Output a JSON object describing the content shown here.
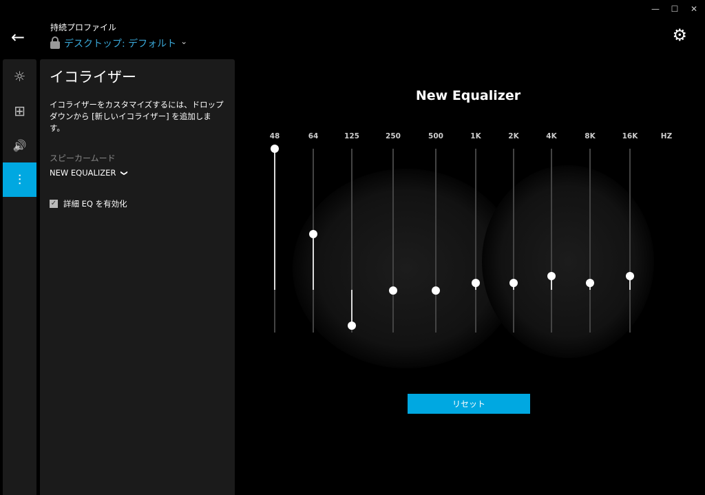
{
  "window": {
    "minimize": "—",
    "maximize": "☐",
    "close": "✕"
  },
  "header": {
    "back_icon": "←",
    "profile_label": "持続プロファイル",
    "profile_value": "デスクトップ: デフォルト",
    "chevron": "⌄",
    "settings_icon": "⚙"
  },
  "rail": {
    "items": [
      {
        "icon": "☼",
        "name": "lighting"
      },
      {
        "icon": "⊞",
        "name": "assignments"
      },
      {
        "icon": "🔊",
        "name": "sound"
      },
      {
        "icon": "⫶",
        "name": "equalizer"
      }
    ]
  },
  "panel": {
    "title": "イコライザー",
    "description": "イコライザーをカスタマイズするには、ドロップダウンから [新しいイコライザー] を追加します。",
    "mode_label": "スピーカームード",
    "mode_value": "NEW EQUALIZER",
    "mode_chevron": "❯",
    "advanced_eq": "詳細 EQ を有効化",
    "advanced_checked": true
  },
  "eq": {
    "title": "New Equalizer",
    "unit": "HZ",
    "accent": "#00a8e1",
    "bands": [
      {
        "label": "48",
        "level": 1.0
      },
      {
        "label": "64",
        "level": 0.536
      },
      {
        "label": "125",
        "level": 0.037
      },
      {
        "label": "250",
        "level": 0.228
      },
      {
        "label": "500",
        "level": 0.228
      },
      {
        "label": "1K",
        "level": 0.27
      },
      {
        "label": "2K",
        "level": 0.27
      },
      {
        "label": "4K",
        "level": 0.307
      },
      {
        "label": "8K",
        "level": 0.27
      },
      {
        "label": "16K",
        "level": 0.307
      }
    ],
    "reset_label": "リセット"
  }
}
